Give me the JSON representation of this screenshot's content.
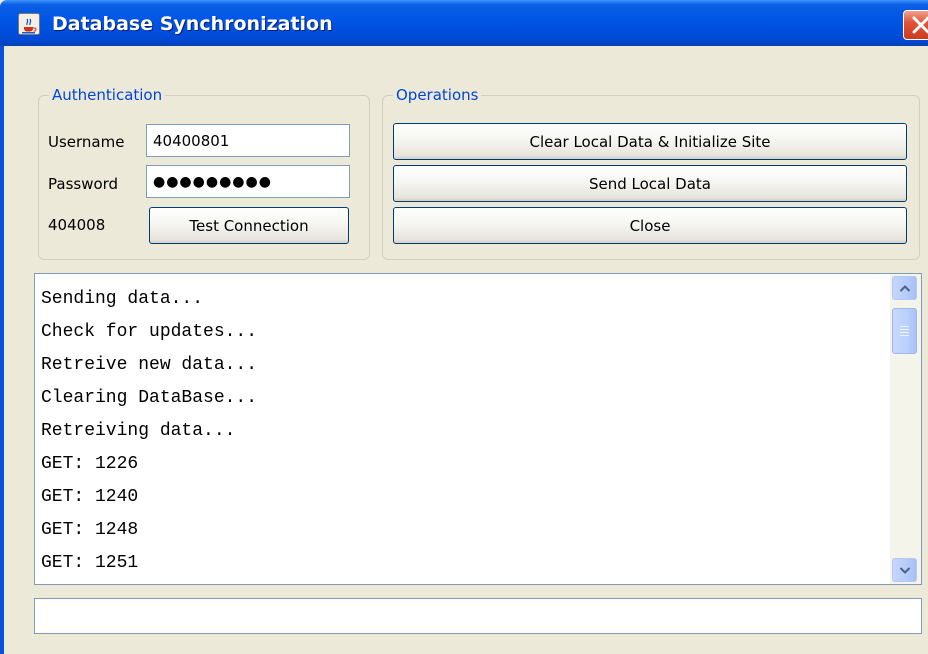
{
  "window": {
    "title": "Database Synchronization",
    "app_icon": "java-cup-icon",
    "close_icon": "close-icon",
    "accent_color": "#0055e5",
    "close_color": "#cc3a1f"
  },
  "authentication": {
    "legend": "Authentication",
    "username_label": "Username",
    "username_value": "40400801",
    "password_label": "Password",
    "password_masked": "●●●●●●●●●",
    "site_code": "404008",
    "test_button": "Test Connection"
  },
  "operations": {
    "legend": "Operations",
    "buttons": [
      {
        "label": "Clear Local Data & Initialize Site"
      },
      {
        "label": "Send Local Data"
      },
      {
        "label": "Close"
      }
    ]
  },
  "log": {
    "lines": [
      "Sending data...",
      "Check for updates...",
      "Retreive new data...",
      "Clearing DataBase...",
      "Retreiving data...",
      "GET: 1226",
      "GET: 1240",
      "GET: 1248",
      "GET: 1251"
    ],
    "scroll_up_icon": "chevron-up-icon",
    "scroll_down_icon": "chevron-down-icon"
  },
  "status": {
    "value": ""
  }
}
